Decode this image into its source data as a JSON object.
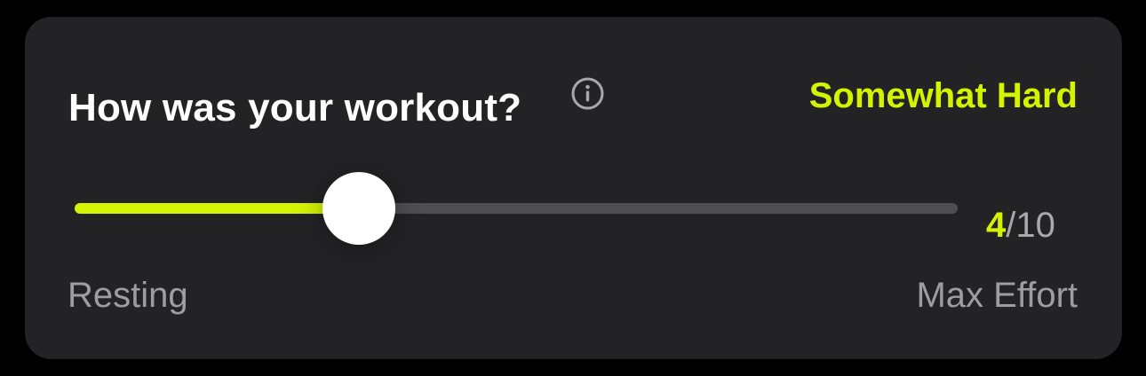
{
  "card": {
    "question": "How was your workout?",
    "info_icon": "info-circle-icon",
    "effort_label": "Somewhat Hard"
  },
  "slider": {
    "value": 4,
    "max": 10,
    "min_label": "Resting",
    "max_label": "Max Effort"
  },
  "score": {
    "value": "4",
    "separator": "/",
    "max": "10"
  },
  "colors": {
    "accent": "#d4f300",
    "card_background": "#232325",
    "page_background": "#000000",
    "track": "#4f4f52",
    "secondary_text": "#9d9da2"
  }
}
